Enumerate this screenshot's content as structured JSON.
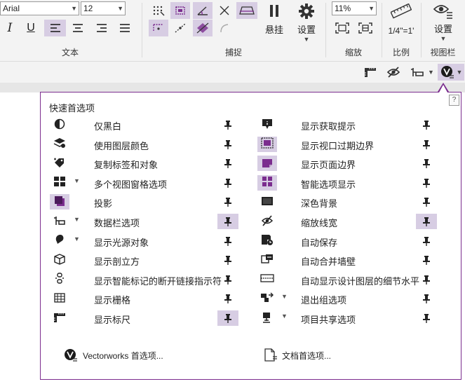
{
  "ribbon": {
    "font_name": "Arial",
    "font_size": "12",
    "text_group_label": "文本",
    "snap_group_label": "捕捉",
    "hang_label": "悬挂",
    "settings_label": "设置",
    "zoom_value": "11%",
    "zoom_group_label": "缩放",
    "scale_value": "1/4\"=1'",
    "scale_group_label": "比例",
    "view_settings_label": "设置",
    "viewbar_group_label": "视图栏"
  },
  "popup": {
    "title": "快速首选项",
    "help": "?",
    "left_items": [
      {
        "label": "仅黑白",
        "icon": "half-circle-icon",
        "icon_on": false,
        "chevron": false,
        "pinned": false
      },
      {
        "label": "使用图层颜色",
        "icon": "layers-color-icon",
        "icon_on": false,
        "chevron": false,
        "pinned": false
      },
      {
        "label": "复制标签和对象",
        "icon": "tag-copy-icon",
        "icon_on": false,
        "chevron": false,
        "pinned": false
      },
      {
        "label": "多个视图窗格选项",
        "icon": "multi-pane-icon",
        "icon_on": false,
        "chevron": true,
        "pinned": false
      },
      {
        "label": "投影",
        "icon": "drop-shadow-icon",
        "icon_on": true,
        "chevron": false,
        "pinned": false
      },
      {
        "label": "数据栏选项",
        "icon": "data-bar-icon",
        "icon_on": false,
        "chevron": true,
        "pinned": true
      },
      {
        "label": "显示光源对象",
        "icon": "light-source-icon",
        "icon_on": false,
        "chevron": true,
        "pinned": false
      },
      {
        "label": "显示剖立方",
        "icon": "section-cube-icon",
        "icon_on": false,
        "chevron": false,
        "pinned": false
      },
      {
        "label": "显示智能标记的断开链接指示符",
        "icon": "broken-link-icon",
        "icon_on": false,
        "chevron": false,
        "pinned": false
      },
      {
        "label": "显示栅格",
        "icon": "grid-icon",
        "icon_on": false,
        "chevron": false,
        "pinned": false
      },
      {
        "label": "显示标尺",
        "icon": "ruler-icon",
        "icon_on": false,
        "chevron": false,
        "pinned": true
      }
    ],
    "right_items": [
      {
        "label": "显示获取提示",
        "icon": "info-tip-icon",
        "icon_on": false,
        "chevron": false,
        "pinned": false
      },
      {
        "label": "显示视口过期边界",
        "icon": "viewport-border-icon",
        "icon_on": true,
        "chevron": false,
        "pinned": false
      },
      {
        "label": "显示页面边界",
        "icon": "page-border-icon",
        "icon_on": true,
        "chevron": false,
        "pinned": false
      },
      {
        "label": "智能选项显示",
        "icon": "smart-options-icon",
        "icon_on": true,
        "chevron": false,
        "pinned": false
      },
      {
        "label": "深色背景",
        "icon": "dark-background-icon",
        "icon_on": false,
        "chevron": false,
        "pinned": false
      },
      {
        "label": "缩放线宽",
        "icon": "zoom-line-weight-icon",
        "icon_on": false,
        "chevron": false,
        "pinned": true
      },
      {
        "label": "自动保存",
        "icon": "auto-save-icon",
        "icon_on": false,
        "chevron": false,
        "pinned": false
      },
      {
        "label": "自动合并墙壁",
        "icon": "merge-walls-icon",
        "icon_on": false,
        "chevron": false,
        "pinned": false
      },
      {
        "label": "自动显示设计图层的细节水平",
        "icon": "detail-level-icon",
        "icon_on": false,
        "chevron": false,
        "pinned": false
      },
      {
        "label": "退出组选项",
        "icon": "exit-group-icon",
        "icon_on": false,
        "chevron": true,
        "pinned": false
      },
      {
        "label": "项目共享选项",
        "icon": "project-sharing-icon",
        "icon_on": false,
        "chevron": true,
        "pinned": false
      }
    ],
    "vw_prefs": "Vectorworks 首选项...",
    "doc_prefs": "文档首选项..."
  },
  "colors": {
    "accent": "#7b2d8e",
    "toggle_bg": "#d7cde3"
  }
}
